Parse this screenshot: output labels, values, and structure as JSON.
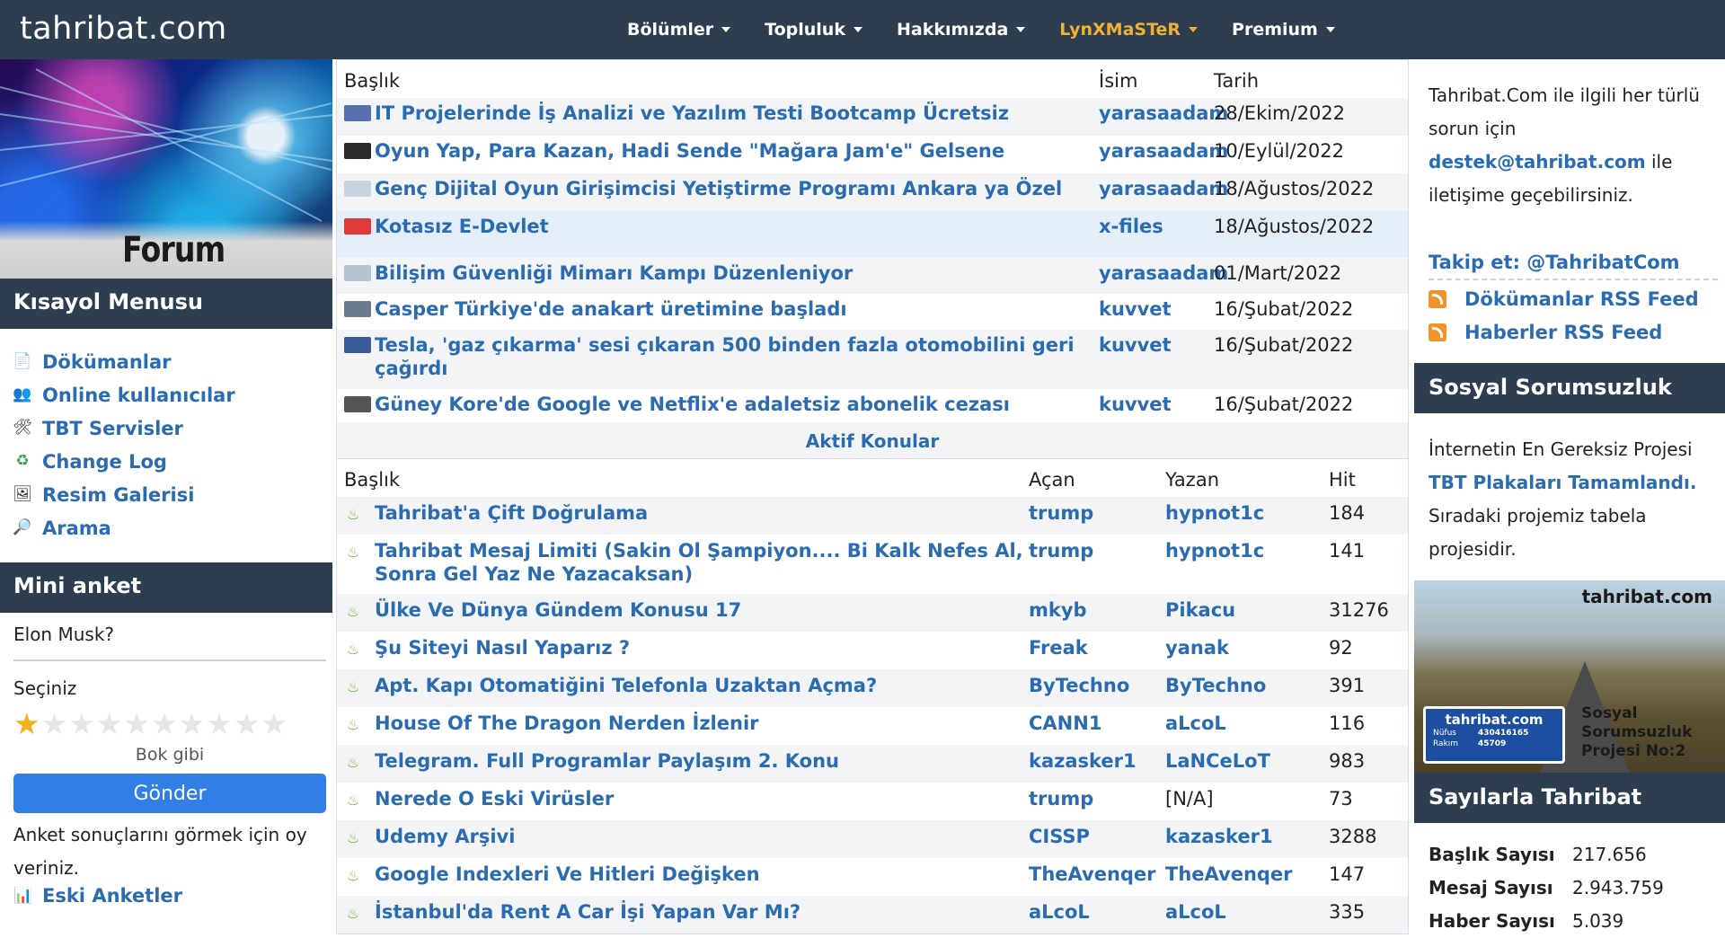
{
  "site": {
    "logo": "tahribat.com"
  },
  "nav": {
    "items": [
      {
        "label": "Bölümler"
      },
      {
        "label": "Topluluk"
      },
      {
        "label": "Hakkımızda"
      },
      {
        "label": "LynXMaSTeR"
      },
      {
        "label": "Premium"
      }
    ],
    "user_color": "#f1b12f"
  },
  "left": {
    "banner_text": "Forum",
    "shortcut_title": "Kısayol Menusu",
    "menu": [
      {
        "label": "Dökümanlar",
        "icon": "document-icon"
      },
      {
        "label": "Online kullanıcılar",
        "icon": "users-icon"
      },
      {
        "label": "TBT Servisler",
        "icon": "tools-icon"
      },
      {
        "label": "Change Log",
        "icon": "refresh-icon"
      },
      {
        "label": "Resim Galerisi",
        "icon": "gallery-icon"
      },
      {
        "label": "Arama",
        "icon": "magnifier-icon"
      }
    ],
    "poll": {
      "title": "Mini anket",
      "question": "Elon Musk?",
      "select_label": "Seçiniz",
      "stars_total": 10,
      "stars_selected": 1,
      "rating_text": "Bok gibi",
      "submit_label": "Gönder",
      "note": "Anket sonuçlarını görmek için oy veriniz.",
      "old_polls": "Eski Anketler"
    }
  },
  "news": {
    "headers": {
      "title": "Başlık",
      "name": "İsim",
      "date": "Tarih"
    },
    "rows": [
      {
        "title": "IT Projelerinde İş Analizi ve Yazılım Testi Bootcamp Ücretsiz",
        "user": "yarasaadam",
        "date": "28/Ekim/2022"
      },
      {
        "title": "Oyun Yap, Para Kazan, Hadi Sende \"Mağara Jam'e\" Gelsene",
        "user": "yarasaadam",
        "date": "10/Eylül/2022"
      },
      {
        "title": "Genç Dijital Oyun Girişimcisi Yetiştirme Programı Ankara ya Özel",
        "user": "yarasaadam",
        "date": "18/Ağustos/2022"
      },
      {
        "title": "Kotasız E-Devlet",
        "user": "x-files",
        "date": "18/Ağustos/2022"
      },
      {
        "title": "Bilişim Güvenliği Mimarı Kampı Düzenleniyor",
        "user": "yarasaadam",
        "date": "01/Mart/2022"
      },
      {
        "title": "Casper Türkiye'de anakart üretimine başladı",
        "user": "kuvvet",
        "date": "16/Şubat/2022"
      },
      {
        "title": "Tesla, 'gaz çıkarma' sesi çıkaran 500 binden fazla otomobilini geri çağırdı",
        "user": "kuvvet",
        "date": "16/Şubat/2022"
      },
      {
        "title": "Güney Kore'de Google ve Netflix'e adaletsiz abonelik cezası",
        "user": "kuvvet",
        "date": "16/Şubat/2022"
      }
    ]
  },
  "active": {
    "section_title": "Aktif Konular",
    "headers": {
      "title": "Başlık",
      "opener": "Açan",
      "writer": "Yazan",
      "hit": "Hit"
    },
    "rows": [
      {
        "title": "Tahribat'a Çift Doğrulama",
        "opener": "trump",
        "writer": "hypnot1c",
        "hit": "184"
      },
      {
        "title": "Tahribat Mesaj Limiti (Sakin Ol Şampiyon.... Bi Kalk Nefes Al, Sonra Gel Yaz Ne Yazacaksan)",
        "opener": "trump",
        "writer": "hypnot1c",
        "hit": "141"
      },
      {
        "title": "Ülke Ve Dünya Gündem Konusu 17",
        "opener": "mkyb",
        "writer": "Pikacu",
        "hit": "31276"
      },
      {
        "title": "Şu Siteyi Nasıl Yaparız ?",
        "opener": "Freak",
        "writer": "yanak",
        "hit": "92"
      },
      {
        "title": "Apt. Kapı Otomatiğini Telefonla Uzaktan Açma?",
        "opener": "ByTechno",
        "writer": "ByTechno",
        "hit": "391"
      },
      {
        "title": "House Of The Dragon Nerden İzlenir",
        "opener": "CANN1",
        "writer": "aLcoL",
        "hit": "116"
      },
      {
        "title": "Telegram. Full Programlar Paylaşım 2. Konu",
        "opener": "kazasker1",
        "writer": "LaNCeLoT",
        "hit": "983"
      },
      {
        "title": "Nerede O Eski Virüsler",
        "opener": "trump",
        "writer": "[N/A]",
        "hit": "73"
      },
      {
        "title": "Udemy Arşivi",
        "opener": "CISSP",
        "writer": "kazasker1",
        "hit": "3288"
      },
      {
        "title": "Google Indexleri Ve Hitleri Değişken",
        "opener": "TheAvenqer",
        "writer": "TheAvenqer",
        "hit": "147"
      },
      {
        "title": "İstanbul'da Rent A Car İşi Yapan Var Mı?",
        "opener": "aLcoL",
        "writer": "aLcoL",
        "hit": "335"
      }
    ]
  },
  "right": {
    "contact_pre": "Tahribat.Com ile ilgili her türlü sorun için",
    "contact_email": "destek@tahribat.com",
    "contact_post": "ile iletişime geçebilirsiniz.",
    "follow": "Takip et: @TahribatCom",
    "rss": [
      {
        "label": "Dökümanlar RSS Feed"
      },
      {
        "label": "Haberler RSS Feed"
      }
    ],
    "social_title": "Sosyal Sorumsuzluk",
    "social_text_pre": "İnternetin En Gereksiz Projesi",
    "social_link": "TBT Plakaları Tamamlandı.",
    "social_text_post": "Sıradaki projemiz tabela projesidir.",
    "plate": {
      "site": "tahribat.com",
      "sign_title": "tahribat.com",
      "sign_row1_label": "Nüfus",
      "sign_row1_value": "430416165",
      "sign_row2_label": "Rakım",
      "sign_row2_value": "45709",
      "caption": "Sosyal Sorumsuzluk Projesi No:2"
    },
    "stats_title": "Sayılarla Tahribat",
    "stats": [
      {
        "label": "Başlık Sayısı",
        "value": "217.656"
      },
      {
        "label": "Mesaj Sayısı",
        "value": "2.943.759"
      },
      {
        "label": "Haber Sayısı",
        "value": "5.039"
      }
    ]
  },
  "colors": {
    "header": "#2c3e50",
    "link": "#2b6cb0",
    "button": "#2f7fe6",
    "star": "#f2b01e"
  }
}
